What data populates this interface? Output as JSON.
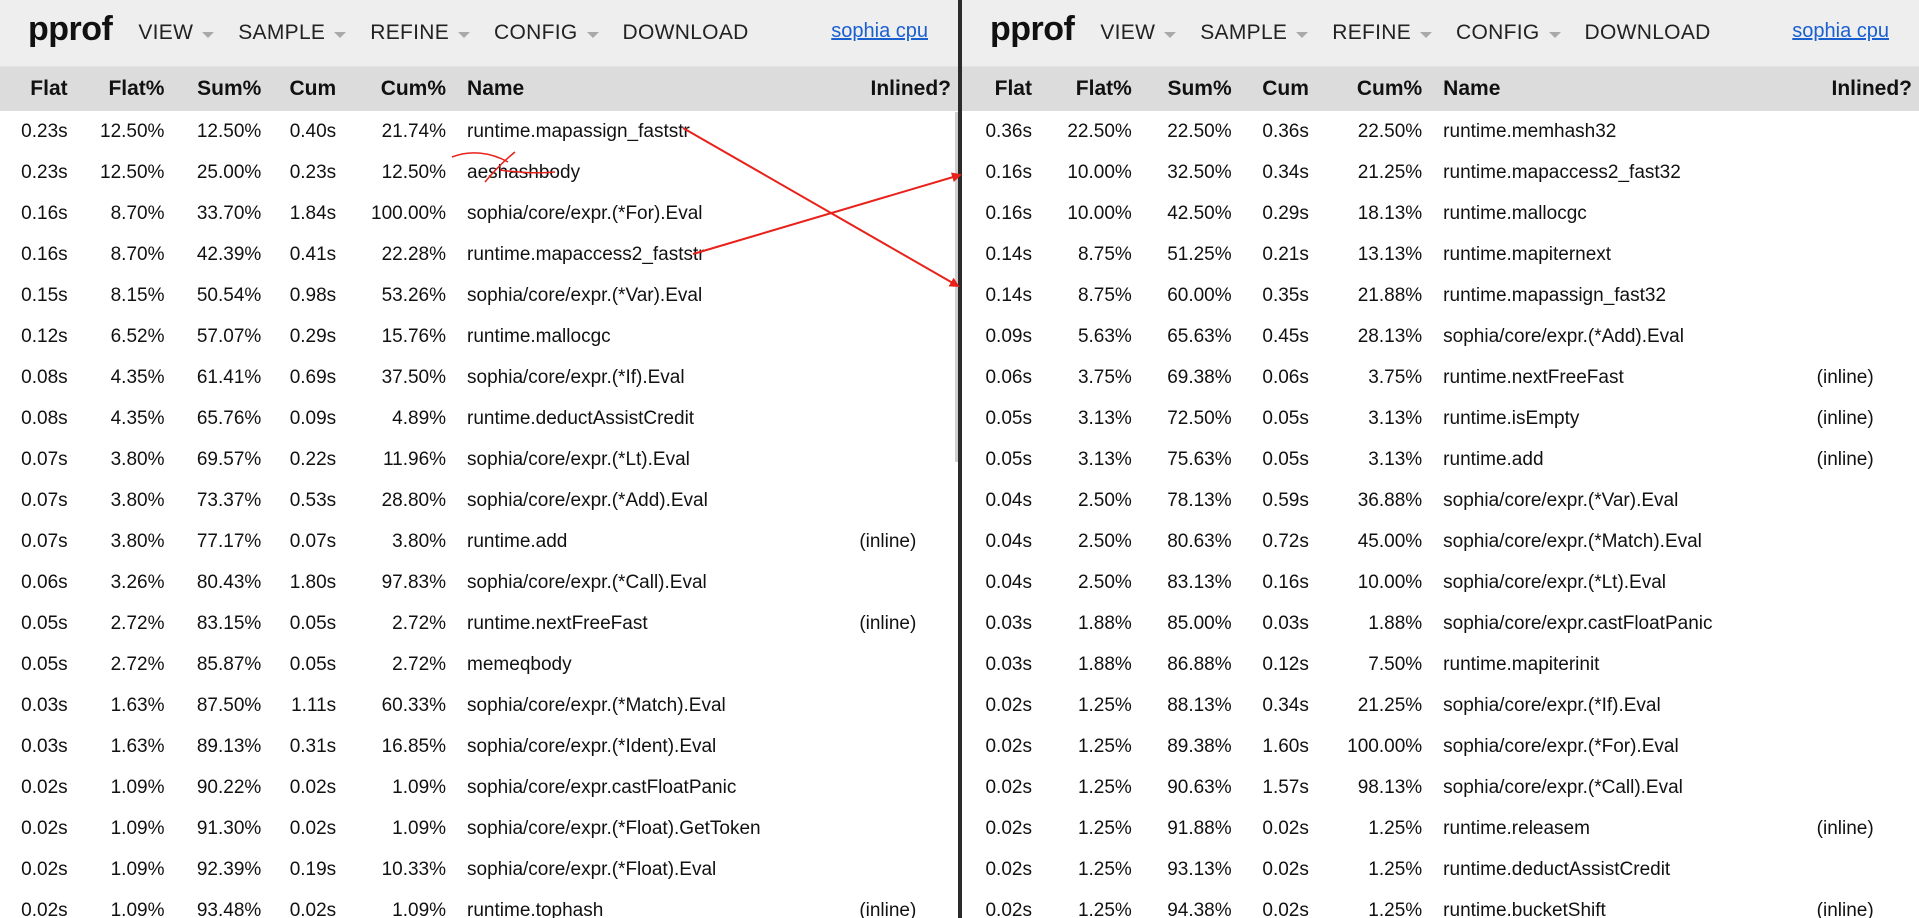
{
  "left": {
    "logo": "pprof",
    "menu": [
      "VIEW",
      "SAMPLE",
      "REFINE",
      "CONFIG",
      "DOWNLOAD"
    ],
    "profile": "sophia cpu",
    "columns": [
      "Flat",
      "Flat%",
      "Sum%",
      "Cum",
      "Cum%",
      "Name",
      "Inlined?"
    ],
    "rows": [
      [
        "0.23s",
        "12.50%",
        "12.50%",
        "0.40s",
        "21.74%",
        "runtime.mapassign_faststr",
        ""
      ],
      [
        "0.23s",
        "12.50%",
        "25.00%",
        "0.23s",
        "12.50%",
        "aeshashbody",
        ""
      ],
      [
        "0.16s",
        "8.70%",
        "33.70%",
        "1.84s",
        "100.00%",
        "sophia/core/expr.(*For).Eval",
        ""
      ],
      [
        "0.16s",
        "8.70%",
        "42.39%",
        "0.41s",
        "22.28%",
        "runtime.mapaccess2_faststr",
        ""
      ],
      [
        "0.15s",
        "8.15%",
        "50.54%",
        "0.98s",
        "53.26%",
        "sophia/core/expr.(*Var).Eval",
        ""
      ],
      [
        "0.12s",
        "6.52%",
        "57.07%",
        "0.29s",
        "15.76%",
        "runtime.mallocgc",
        ""
      ],
      [
        "0.08s",
        "4.35%",
        "61.41%",
        "0.69s",
        "37.50%",
        "sophia/core/expr.(*If).Eval",
        ""
      ],
      [
        "0.08s",
        "4.35%",
        "65.76%",
        "0.09s",
        "4.89%",
        "runtime.deductAssistCredit",
        ""
      ],
      [
        "0.07s",
        "3.80%",
        "69.57%",
        "0.22s",
        "11.96%",
        "sophia/core/expr.(*Lt).Eval",
        ""
      ],
      [
        "0.07s",
        "3.80%",
        "73.37%",
        "0.53s",
        "28.80%",
        "sophia/core/expr.(*Add).Eval",
        ""
      ],
      [
        "0.07s",
        "3.80%",
        "77.17%",
        "0.07s",
        "3.80%",
        "runtime.add",
        "(inline)"
      ],
      [
        "0.06s",
        "3.26%",
        "80.43%",
        "1.80s",
        "97.83%",
        "sophia/core/expr.(*Call).Eval",
        ""
      ],
      [
        "0.05s",
        "2.72%",
        "83.15%",
        "0.05s",
        "2.72%",
        "runtime.nextFreeFast",
        "(inline)"
      ],
      [
        "0.05s",
        "2.72%",
        "85.87%",
        "0.05s",
        "2.72%",
        "memeqbody",
        ""
      ],
      [
        "0.03s",
        "1.63%",
        "87.50%",
        "1.11s",
        "60.33%",
        "sophia/core/expr.(*Match).Eval",
        ""
      ],
      [
        "0.03s",
        "1.63%",
        "89.13%",
        "0.31s",
        "16.85%",
        "sophia/core/expr.(*Ident).Eval",
        ""
      ],
      [
        "0.02s",
        "1.09%",
        "90.22%",
        "0.02s",
        "1.09%",
        "sophia/core/expr.castFloatPanic",
        ""
      ],
      [
        "0.02s",
        "1.09%",
        "91.30%",
        "0.02s",
        "1.09%",
        "sophia/core/expr.(*Float).GetToken",
        ""
      ],
      [
        "0.02s",
        "1.09%",
        "92.39%",
        "0.19s",
        "10.33%",
        "sophia/core/expr.(*Float).Eval",
        ""
      ],
      [
        "0.02s",
        "1.09%",
        "93.48%",
        "0.02s",
        "1.09%",
        "runtime.tophash",
        "(inline)"
      ]
    ]
  },
  "right": {
    "logo": "pprof",
    "menu": [
      "VIEW",
      "SAMPLE",
      "REFINE",
      "CONFIG",
      "DOWNLOAD"
    ],
    "profile": "sophia cpu",
    "columns": [
      "Flat",
      "Flat%",
      "Sum%",
      "Cum",
      "Cum%",
      "Name",
      "Inlined?"
    ],
    "rows": [
      [
        "0.36s",
        "22.50%",
        "22.50%",
        "0.36s",
        "22.50%",
        "runtime.memhash32",
        ""
      ],
      [
        "0.16s",
        "10.00%",
        "32.50%",
        "0.34s",
        "21.25%",
        "runtime.mapaccess2_fast32",
        ""
      ],
      [
        "0.16s",
        "10.00%",
        "42.50%",
        "0.29s",
        "18.13%",
        "runtime.mallocgc",
        ""
      ],
      [
        "0.14s",
        "8.75%",
        "51.25%",
        "0.21s",
        "13.13%",
        "runtime.mapiternext",
        ""
      ],
      [
        "0.14s",
        "8.75%",
        "60.00%",
        "0.35s",
        "21.88%",
        "runtime.mapassign_fast32",
        ""
      ],
      [
        "0.09s",
        "5.63%",
        "65.63%",
        "0.45s",
        "28.13%",
        "sophia/core/expr.(*Add).Eval",
        ""
      ],
      [
        "0.06s",
        "3.75%",
        "69.38%",
        "0.06s",
        "3.75%",
        "runtime.nextFreeFast",
        "(inline)"
      ],
      [
        "0.05s",
        "3.13%",
        "72.50%",
        "0.05s",
        "3.13%",
        "runtime.isEmpty",
        "(inline)"
      ],
      [
        "0.05s",
        "3.13%",
        "75.63%",
        "0.05s",
        "3.13%",
        "runtime.add",
        "(inline)"
      ],
      [
        "0.04s",
        "2.50%",
        "78.13%",
        "0.59s",
        "36.88%",
        "sophia/core/expr.(*Var).Eval",
        ""
      ],
      [
        "0.04s",
        "2.50%",
        "80.63%",
        "0.72s",
        "45.00%",
        "sophia/core/expr.(*Match).Eval",
        ""
      ],
      [
        "0.04s",
        "2.50%",
        "83.13%",
        "0.16s",
        "10.00%",
        "sophia/core/expr.(*Lt).Eval",
        ""
      ],
      [
        "0.03s",
        "1.88%",
        "85.00%",
        "0.03s",
        "1.88%",
        "sophia/core/expr.castFloatPanic",
        ""
      ],
      [
        "0.03s",
        "1.88%",
        "86.88%",
        "0.12s",
        "7.50%",
        "runtime.mapiterinit",
        ""
      ],
      [
        "0.02s",
        "1.25%",
        "88.13%",
        "0.34s",
        "21.25%",
        "sophia/core/expr.(*If).Eval",
        ""
      ],
      [
        "0.02s",
        "1.25%",
        "89.38%",
        "1.60s",
        "100.00%",
        "sophia/core/expr.(*For).Eval",
        ""
      ],
      [
        "0.02s",
        "1.25%",
        "90.63%",
        "1.57s",
        "98.13%",
        "sophia/core/expr.(*Call).Eval",
        ""
      ],
      [
        "0.02s",
        "1.25%",
        "91.88%",
        "0.02s",
        "1.25%",
        "runtime.releasem",
        "(inline)"
      ],
      [
        "0.02s",
        "1.25%",
        "93.13%",
        "0.02s",
        "1.25%",
        "runtime.deductAssistCredit",
        ""
      ],
      [
        "0.02s",
        "1.25%",
        "94.38%",
        "0.02s",
        "1.25%",
        "runtime.bucketShift",
        "(inline)"
      ]
    ]
  },
  "annotations": {
    "arrow_color": "#e8221b",
    "arrows": [
      {
        "from": "runtime.mapassign_faststr",
        "to": "runtime.mapassign_fast32"
      },
      {
        "from": "runtime.mapaccess2_faststr",
        "to": "runtime.mapaccess2_fast32"
      }
    ],
    "crossed_out": "aeshashbody"
  }
}
